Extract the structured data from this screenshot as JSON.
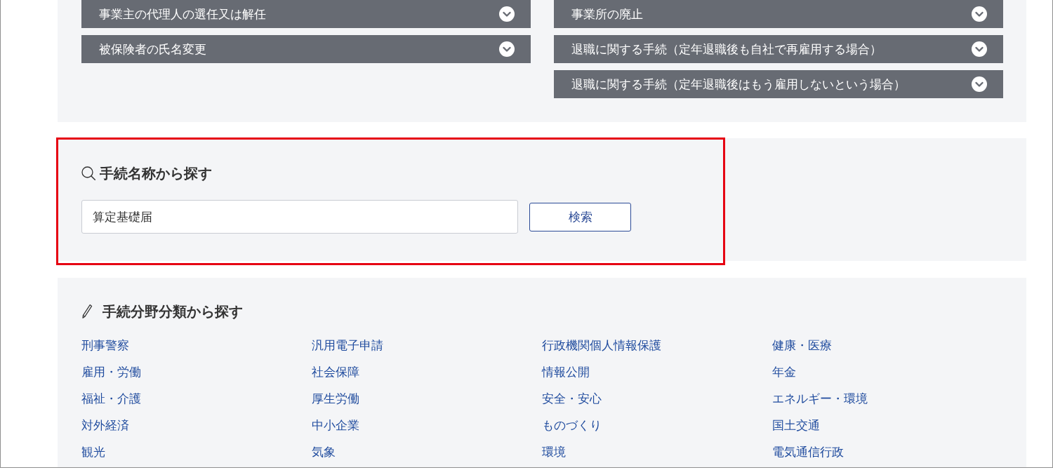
{
  "accordion_columns": [
    {
      "items": [
        {
          "label": "事業主の代理人の選任又は解任",
          "expanded": false
        },
        {
          "label": "被保険者の氏名変更",
          "expanded": false
        }
      ]
    },
    {
      "items": [
        {
          "label": "事業所の廃止",
          "expanded": false
        },
        {
          "label": "退職に関する手続（定年退職後も自社で再雇用する場合）",
          "expanded": false
        },
        {
          "label": "退職に関する手続（定年退職後はもう雇用しないという場合）",
          "expanded": false
        }
      ]
    }
  ],
  "name_search": {
    "highlighted": true,
    "title": "手続名称から探す",
    "field": {
      "value": "算定基礎届"
    },
    "button": "検索"
  },
  "category_search": {
    "title": "手続分野分類から探す",
    "links": [
      "刑事警察",
      "汎用電子申請",
      "行政機関個人情報保護",
      "健康・医療",
      "雇用・労働",
      "社会保障",
      "情報公開",
      "年金",
      "福祉・介護",
      "厚生労働",
      "安全・安心",
      "エネルギー・環境",
      "対外経済",
      "中小企業",
      "ものづくり",
      "国土交通",
      "観光",
      "気象",
      "環境",
      "電気通信行政"
    ]
  }
}
